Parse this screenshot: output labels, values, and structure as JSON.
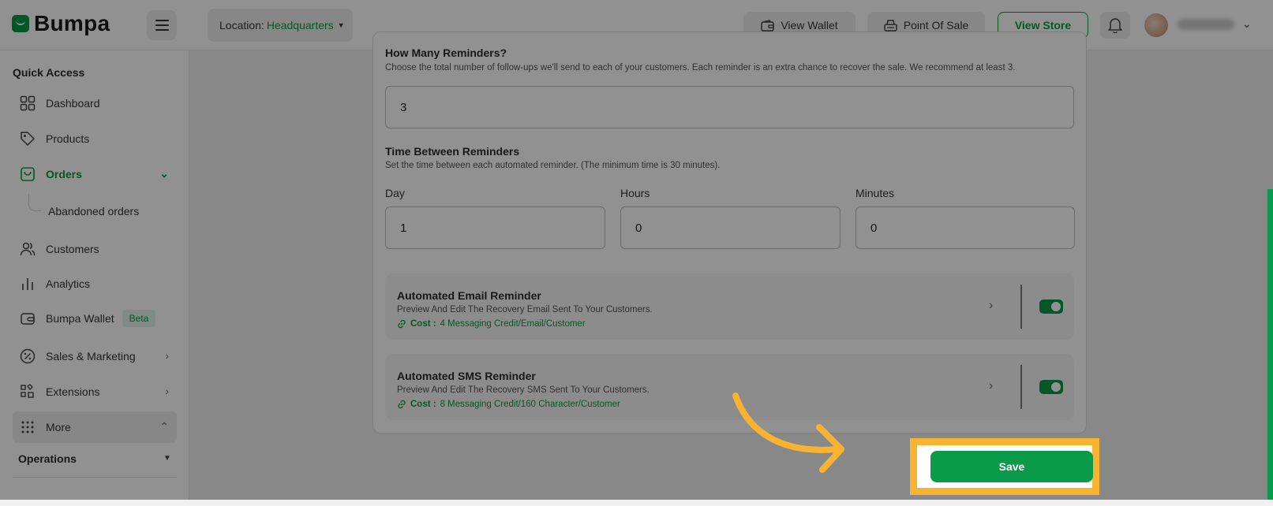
{
  "app": {
    "logo": "Bumpa"
  },
  "header": {
    "location_label": "Location:",
    "location_value": "Headquarters",
    "view_wallet": "View Wallet",
    "point_of_sale": "Point Of Sale",
    "view_store": "View Store"
  },
  "sidebar": {
    "section_title": "Quick Access",
    "items": [
      {
        "label": "Dashboard",
        "icon": "grid-icon"
      },
      {
        "label": "Products",
        "icon": "tag-icon"
      },
      {
        "label": "Orders",
        "icon": "shopping-bag-icon"
      },
      {
        "label": "Customers",
        "icon": "users-icon"
      },
      {
        "label": "Analytics",
        "icon": "bar-chart-icon"
      },
      {
        "label": "Bumpa Wallet",
        "icon": "wallet-icon",
        "badge": "Beta"
      },
      {
        "label": "Sales & Marketing",
        "icon": "percent-icon"
      },
      {
        "label": "Extensions",
        "icon": "extensions-icon"
      },
      {
        "label": "More",
        "icon": "dots-grid-icon"
      }
    ],
    "sub_item": "Abandoned orders",
    "operations": "Operations"
  },
  "form": {
    "reminders_title": "How Many Reminders?",
    "reminders_desc": "Choose the total number of follow-ups we'll send to each of your customers. Each reminder is an extra chance to recover the sale. We recommend at least 3.",
    "reminders_value": "3",
    "time_title": "Time Between Reminders",
    "time_desc": "Set the time between each automated reminder. (The minimum time is 30 minutes).",
    "day_label": "Day",
    "day_value": "1",
    "hours_label": "Hours",
    "hours_value": "0",
    "minutes_label": "Minutes",
    "minutes_value": "0"
  },
  "reminders": [
    {
      "title": "Automated Email Reminder",
      "desc": "Preview And Edit The Recovery Email Sent To Your Customers.",
      "cost_label": "Cost :",
      "cost_value": "4 Messaging Credit/Email/Customer",
      "enabled": true
    },
    {
      "title": "Automated SMS Reminder",
      "desc": "Preview And Edit The Recovery SMS Sent To Your Customers.",
      "cost_label": "Cost :",
      "cost_value": "8 Messaging Credit/160 Character/Customer",
      "enabled": true
    }
  ],
  "actions": {
    "save": "Save"
  },
  "colors": {
    "brand": "#0a9a4a",
    "highlight": "#f8b431"
  }
}
